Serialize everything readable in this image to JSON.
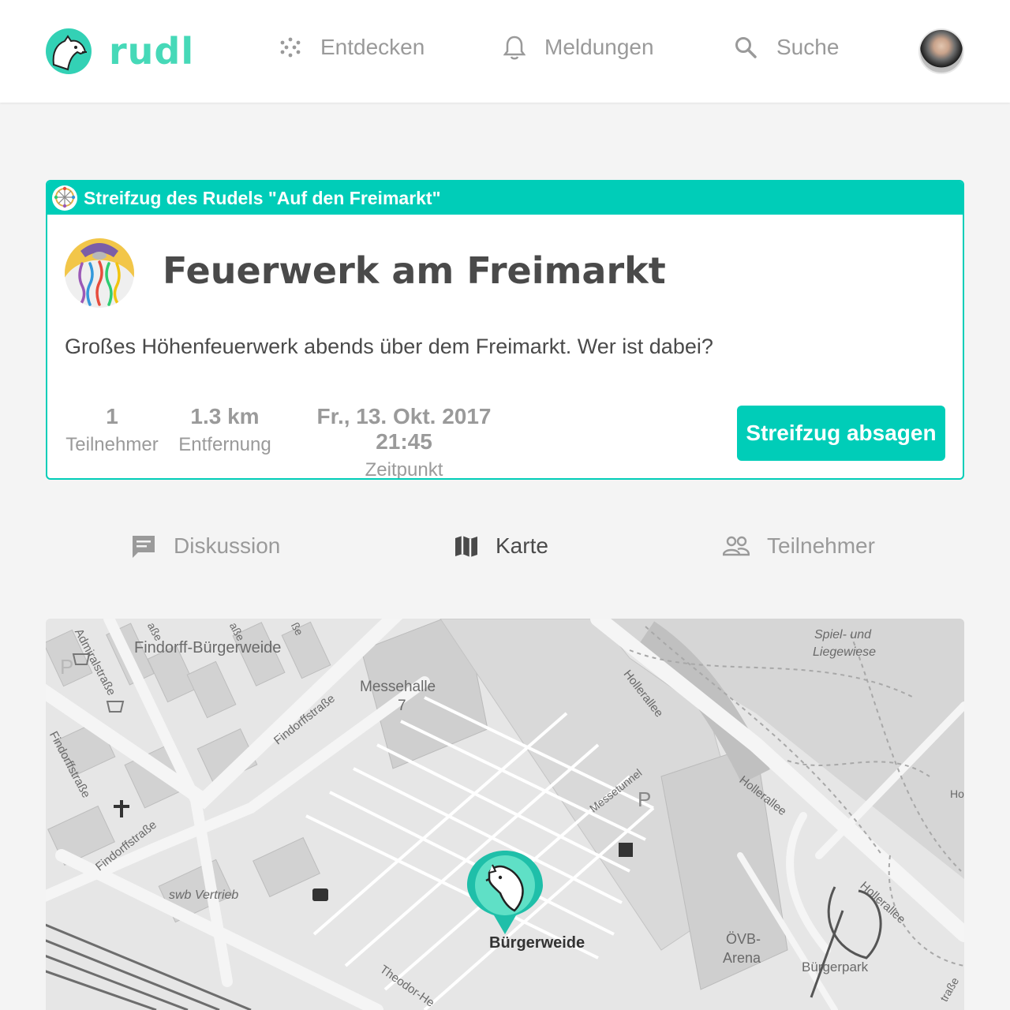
{
  "header": {
    "logo_text": "rudl",
    "nav": [
      {
        "label": "Entdecken",
        "icon": "dots-icon"
      },
      {
        "label": "Meldungen",
        "icon": "bell-icon"
      },
      {
        "label": "Suche",
        "icon": "search-icon"
      }
    ]
  },
  "event": {
    "banner": "Streifzug des Rudels \"Auf den Freimarkt\"",
    "title": "Feuerwerk am Freimarkt",
    "description": "Großes Höhenfeuerwerk abends über dem Freimarkt. Wer ist dabei?",
    "stats": [
      {
        "value": "1",
        "label": "Teilnehmer"
      },
      {
        "value": "1.3 km",
        "label": "Entfernung"
      },
      {
        "value": "Fr., 13. Okt. 2017 21:45",
        "label": "Zeitpunkt"
      }
    ],
    "cancel_label": "Streifzug absagen"
  },
  "tabs": [
    {
      "label": "Diskussion",
      "icon": "chat-icon",
      "active": false
    },
    {
      "label": "Karte",
      "icon": "map-icon",
      "active": true
    },
    {
      "label": "Teilnehmer",
      "icon": "people-icon",
      "active": false
    }
  ],
  "map": {
    "labels": {
      "findorff_buergerweide": "Findorff-Bürgerweide",
      "messehalle": "Messehalle",
      "messehalle_num": "7",
      "admiralstrasse": "Admiralstraße",
      "findorffstrasse_1": "Findorffstraße",
      "findorffstrasse_2": "Findorffstraße",
      "findorffstrasse_3": "Findorffstraße",
      "hollerallee_1": "Hollerallee",
      "hollerallee_2": "Hollerallee",
      "hollerallee_3": "Hollerallee",
      "messetunnel": "Messetunnel",
      "spiel_und": "Spiel- und",
      "liegewiese": "Liegewiese",
      "swb_vertrieb": "swb Vertrieb",
      "oevb": "ÖVB-",
      "arena": "Arena",
      "buergerpark": "Bürgerpark",
      "theodor": "Theodor-He",
      "strasse_a": "aße",
      "strasse_b": "aße",
      "strasse_c": "ße",
      "strasse_d": "traße",
      "parking": "P",
      "ho": "Ho"
    },
    "pin_label": "Bürgerweide"
  },
  "colors": {
    "accent": "#00cdb8",
    "logo": "#46d9b8"
  }
}
